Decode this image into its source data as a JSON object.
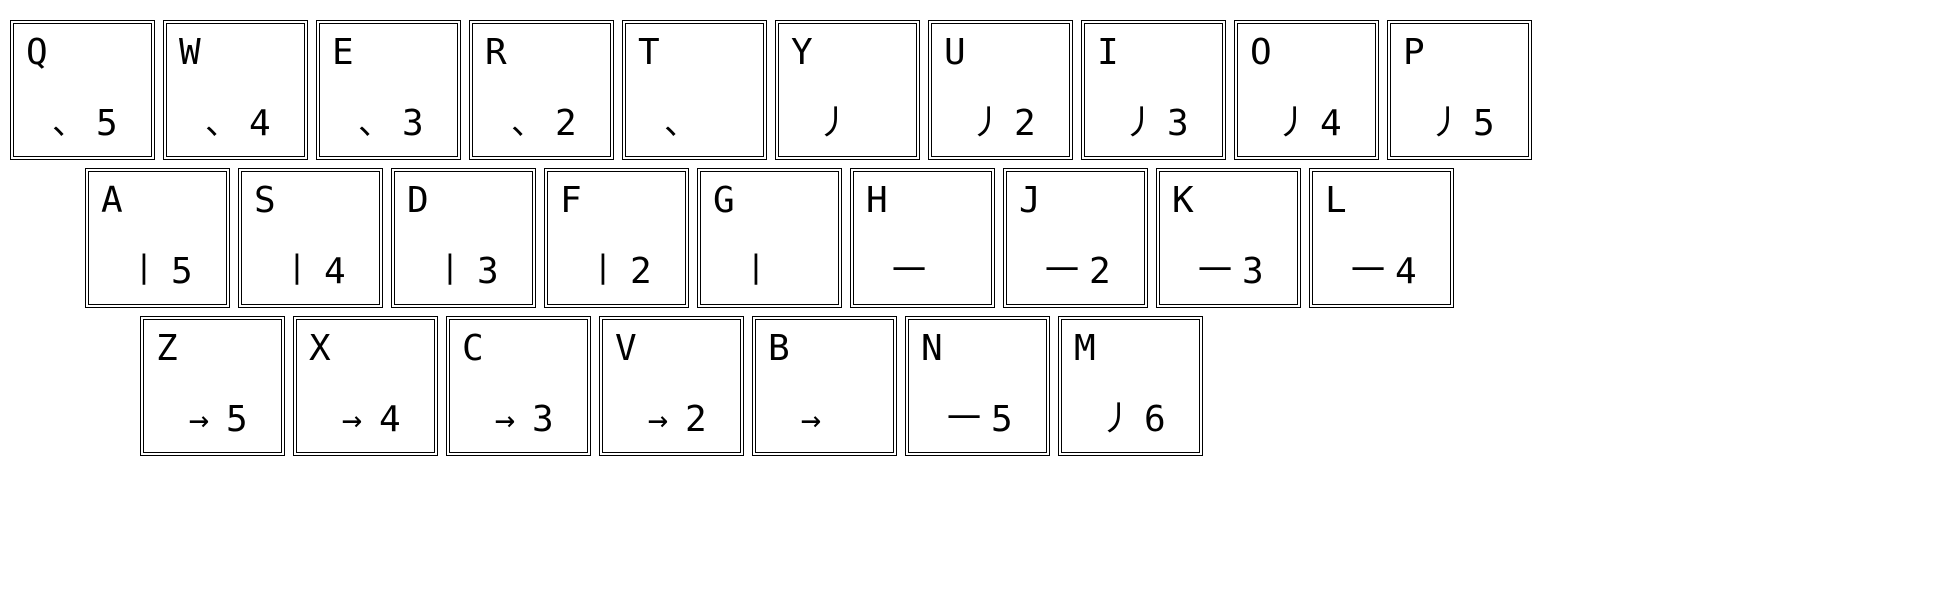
{
  "rows": [
    [
      {
        "letter": "Q",
        "stroke": "、",
        "number": "5"
      },
      {
        "letter": "W",
        "stroke": "、",
        "number": "4"
      },
      {
        "letter": "E",
        "stroke": "、",
        "number": "3"
      },
      {
        "letter": "R",
        "stroke": "、",
        "number": "2"
      },
      {
        "letter": "T",
        "stroke": "、",
        "number": ""
      },
      {
        "letter": "Y",
        "stroke": "丿",
        "number": ""
      },
      {
        "letter": "U",
        "stroke": "丿",
        "number": "2"
      },
      {
        "letter": "I",
        "stroke": "丿",
        "number": "3"
      },
      {
        "letter": "O",
        "stroke": "丿",
        "number": "4"
      },
      {
        "letter": "P",
        "stroke": "丿",
        "number": "5"
      }
    ],
    [
      {
        "letter": "A",
        "stroke": "丨",
        "number": "5"
      },
      {
        "letter": "S",
        "stroke": "丨",
        "number": "4"
      },
      {
        "letter": "D",
        "stroke": "丨",
        "number": "3"
      },
      {
        "letter": "F",
        "stroke": "丨",
        "number": "2"
      },
      {
        "letter": "G",
        "stroke": "丨",
        "number": ""
      },
      {
        "letter": "H",
        "stroke": "一",
        "number": ""
      },
      {
        "letter": "J",
        "stroke": "一",
        "number": "2"
      },
      {
        "letter": "K",
        "stroke": "一",
        "number": "3"
      },
      {
        "letter": "L",
        "stroke": "一",
        "number": "4"
      }
    ],
    [
      {
        "letter": "Z",
        "stroke": "→",
        "number": "5"
      },
      {
        "letter": "X",
        "stroke": "→",
        "number": "4"
      },
      {
        "letter": "C",
        "stroke": "→",
        "number": "3"
      },
      {
        "letter": "V",
        "stroke": "→",
        "number": "2"
      },
      {
        "letter": "B",
        "stroke": "→",
        "number": ""
      },
      {
        "letter": "N",
        "stroke": "一",
        "number": "5"
      },
      {
        "letter": "M",
        "stroke": "丿",
        "number": "6"
      }
    ]
  ]
}
